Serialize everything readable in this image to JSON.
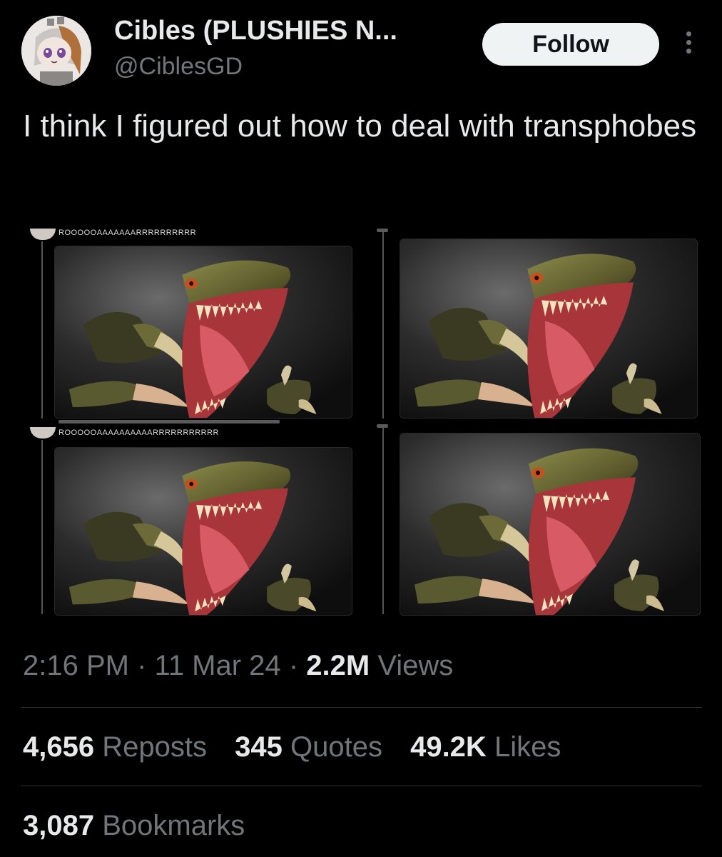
{
  "author": {
    "display_name": "Cibles (PLUSHIES N...",
    "handle": "@CiblesGD",
    "follow_label": "Follow"
  },
  "tweet": {
    "text": "I think I figured out how to deal with transphobes"
  },
  "media": {
    "panels": [
      {
        "caption": "ROOOOOAAAAAAARRRRRRRRRR"
      },
      {
        "caption": ""
      },
      {
        "caption": "ROOOOOAAAAAAAAAARRRRRRRRRRR"
      },
      {
        "caption": ""
      }
    ]
  },
  "meta": {
    "time": "2:16 PM",
    "date": "11 Mar 24",
    "views_count": "2.2M",
    "views_label": "Views",
    "separator": "·"
  },
  "stats": {
    "reposts_count": "4,656",
    "reposts_label": "Reposts",
    "quotes_count": "345",
    "quotes_label": "Quotes",
    "likes_count": "49.2K",
    "likes_label": "Likes",
    "bookmarks_count": "3,087",
    "bookmarks_label": "Bookmarks"
  },
  "icons": {
    "more": "more-vertical-icon",
    "avatar": "avatar"
  },
  "colors": {
    "background": "#000000",
    "text_primary": "#e7e9ea",
    "text_secondary": "#71767b",
    "follow_bg": "#eff3f4",
    "divider": "#2f3336"
  }
}
